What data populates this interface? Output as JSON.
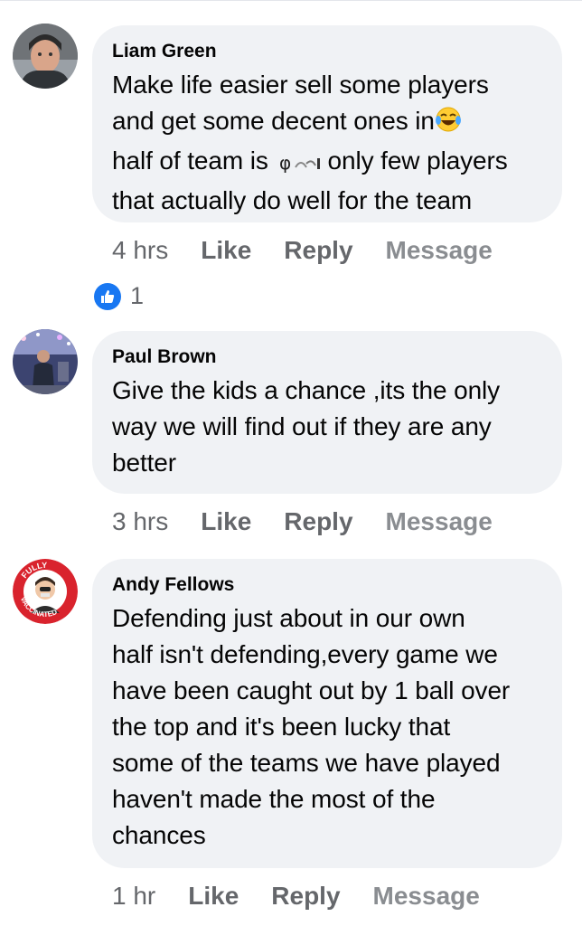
{
  "comments": [
    {
      "author": "Liam Green",
      "lines": [
        "Make life easier sell some players",
        "and get some decent ones in",
        "half of team is",
        "only few players",
        "that actually do well for the team"
      ],
      "time": "4 hrs",
      "actions": {
        "like": "Like",
        "reply": "Reply",
        "message": "Message"
      },
      "reaction_count": "1"
    },
    {
      "author": "Paul Brown",
      "lines": [
        "Give the kids a chance ,its the only",
        "way we will find out if they are any",
        "better"
      ],
      "time": "3 hrs",
      "actions": {
        "like": "Like",
        "reply": "Reply",
        "message": "Message"
      }
    },
    {
      "author": "Andy Fellows",
      "lines": [
        "Defending just about in our own",
        "half isn't defending,every game we",
        "have been caught out by 1 ball over",
        "the top and it's been lucky that",
        "some of the teams we have played",
        "haven't made the most of the",
        "chances"
      ],
      "avatar_badge_top": "FULLY",
      "avatar_badge_bottom": "VACCINATED",
      "time": "1 hr",
      "actions": {
        "like": "Like",
        "reply": "Reply",
        "message": "Message"
      }
    }
  ],
  "colors": {
    "bubble": "#f0f2f5",
    "meta": "#65676b",
    "like_blue": "#1877f2"
  }
}
